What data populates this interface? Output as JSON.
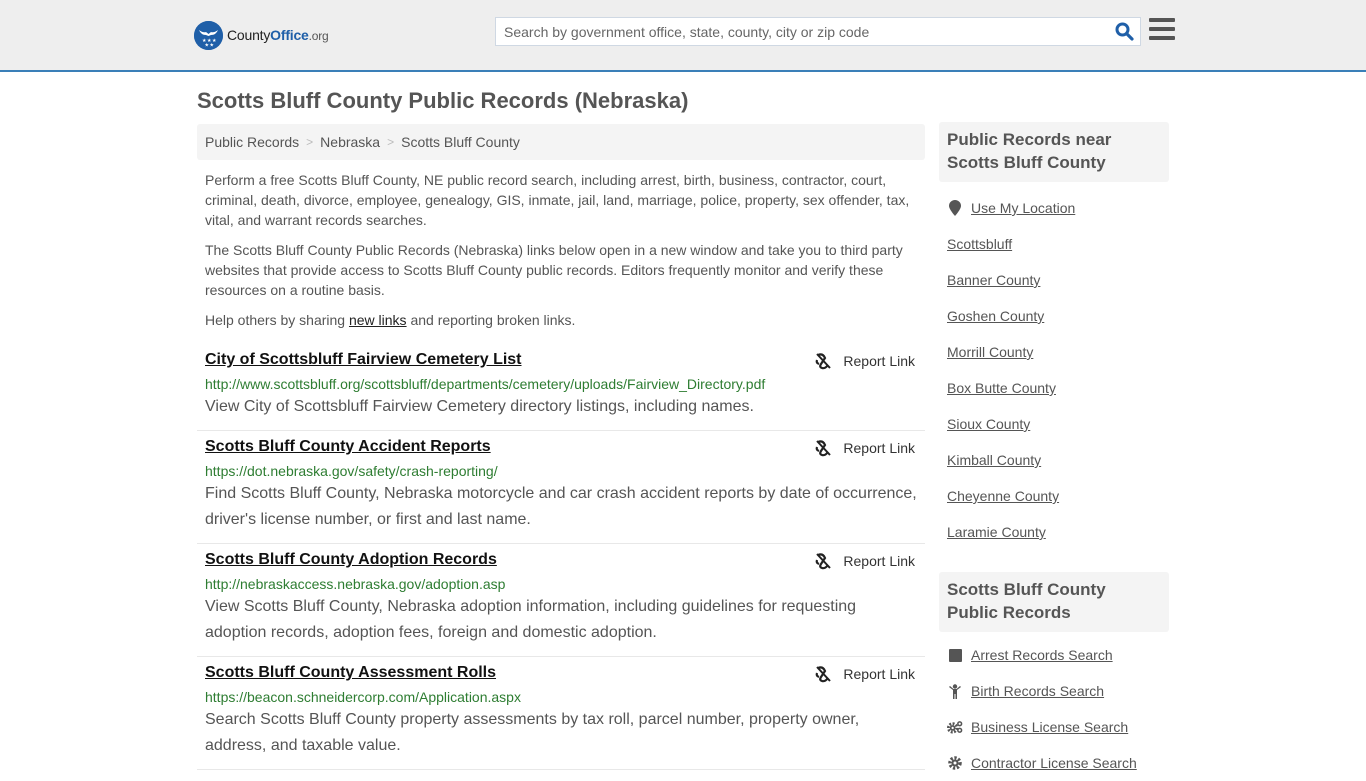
{
  "header": {
    "logo": {
      "name_part1": "County",
      "name_part2": "Office",
      "name_part3": ".org"
    },
    "search": {
      "placeholder": "Search by government office, state, county, city or zip code",
      "value": ""
    },
    "colors": {
      "brand": "#1f5fa8",
      "header_bg": "#eeeeee",
      "header_border": "#3a7fb8"
    }
  },
  "page": {
    "title": "Scotts Bluff County Public Records (Nebraska)",
    "breadcrumb": [
      "Public Records",
      "Nebraska",
      "Scotts Bluff County"
    ],
    "intro": {
      "p1": "Perform a free Scotts Bluff County, NE public record search, including arrest, birth, business, contractor, court, criminal, death, divorce, employee, genealogy, GIS, inmate, jail, land, marriage, police, property, sex offender, tax, vital, and warrant records searches.",
      "p2": "The Scotts Bluff County Public Records (Nebraska) links below open in a new window and take you to third party websites that provide access to Scotts Bluff County public records. Editors frequently monitor and verify these resources on a routine basis.",
      "p3_before": "Help others by sharing ",
      "p3_link": "new links",
      "p3_after": " and reporting broken links."
    }
  },
  "results": [
    {
      "title": "City of Scottsbluff Fairview Cemetery List",
      "url": "http://www.scottsbluff.org/scottsbluff/departments/cemetery/uploads/Fairview_Directory.pdf",
      "description": "View City of Scottsbluff Fairview Cemetery directory listings, including names.",
      "report_label": "Report Link"
    },
    {
      "title": "Scotts Bluff County Accident Reports",
      "url": "https://dot.nebraska.gov/safety/crash-reporting/",
      "description": "Find Scotts Bluff County, Nebraska motorcycle and car crash accident reports by date of occurrence, driver's license number, or first and last name.",
      "report_label": "Report Link"
    },
    {
      "title": "Scotts Bluff County Adoption Records",
      "url": "http://nebraskaccess.nebraska.gov/adoption.asp",
      "description": "View Scotts Bluff County, Nebraska adoption information, including guidelines for requesting adoption records, adoption fees, foreign and domestic adoption.",
      "report_label": "Report Link"
    },
    {
      "title": "Scotts Bluff County Assessment Rolls",
      "url": "https://beacon.schneidercorp.com/Application.aspx",
      "description": "Search Scotts Bluff County property assessments by tax roll, parcel number, property owner, address, and taxable value.",
      "report_label": "Report Link"
    }
  ],
  "sidebar": {
    "nearby": {
      "heading": "Public Records near Scotts Bluff County",
      "use_location": {
        "label": "Use My Location",
        "icon": "map-pin-icon"
      },
      "items": [
        "Scottsbluff",
        "Banner County",
        "Goshen County",
        "Morrill County",
        "Box Butte County",
        "Sioux County",
        "Kimball County",
        "Cheyenne County",
        "Laramie County"
      ]
    },
    "records": {
      "heading": "Scotts Bluff County Public Records",
      "items": [
        {
          "label": "Arrest Records Search",
          "icon": "square-icon"
        },
        {
          "label": "Birth Records Search",
          "icon": "child-icon"
        },
        {
          "label": "Business License Search",
          "icon": "cogs-icon"
        },
        {
          "label": "Contractor License Search",
          "icon": "gear-icon"
        }
      ]
    }
  }
}
